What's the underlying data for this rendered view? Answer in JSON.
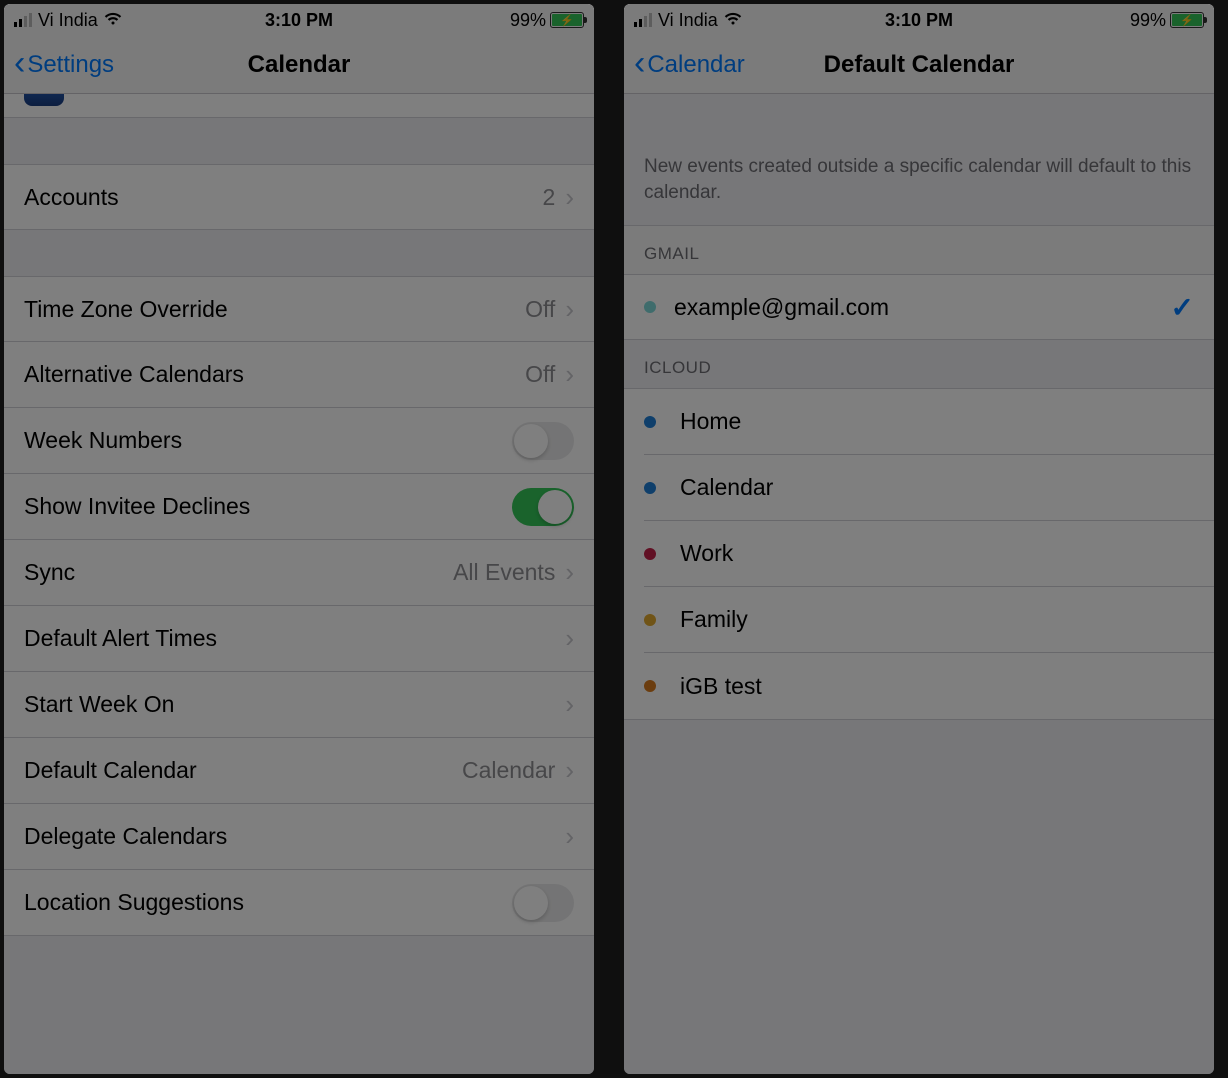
{
  "statusbar": {
    "carrier": "Vi India",
    "time": "3:10 PM",
    "battery_pct": "99%"
  },
  "left": {
    "back_label": "Settings",
    "title": "Calendar",
    "rows": {
      "accounts": {
        "label": "Accounts",
        "value": "2"
      },
      "timezone": {
        "label": "Time Zone Override",
        "value": "Off"
      },
      "altcal": {
        "label": "Alternative Calendars",
        "value": "Off"
      },
      "weeknum": {
        "label": "Week Numbers",
        "switch": "off"
      },
      "invitee": {
        "label": "Show Invitee Declines",
        "switch": "on"
      },
      "sync": {
        "label": "Sync",
        "value": "All Events"
      },
      "alert": {
        "label": "Default Alert Times"
      },
      "startweek": {
        "label": "Start Week On"
      },
      "defaultcal": {
        "label": "Default Calendar",
        "value": "Calendar"
      },
      "delegate": {
        "label": "Delegate Calendars"
      },
      "location": {
        "label": "Location Suggestions",
        "switch": "off"
      }
    }
  },
  "right": {
    "back_label": "Calendar",
    "title": "Default Calendar",
    "description": "New events created outside a specific calendar will default to this calendar.",
    "sections": {
      "gmail": {
        "header": "GMAIL",
        "items": [
          {
            "name": "example@gmail.com",
            "color": "#7fd8d8",
            "selected": true
          }
        ]
      },
      "icloud": {
        "header": "ICLOUD",
        "items": [
          {
            "name": "Home",
            "color": "#1e7fd6"
          },
          {
            "name": "Calendar",
            "color": "#1e7fd6"
          },
          {
            "name": "Work",
            "color": "#c32148"
          },
          {
            "name": "Family",
            "color": "#e0a82e"
          },
          {
            "name": "iGB test",
            "color": "#d67b1e"
          }
        ]
      }
    }
  }
}
